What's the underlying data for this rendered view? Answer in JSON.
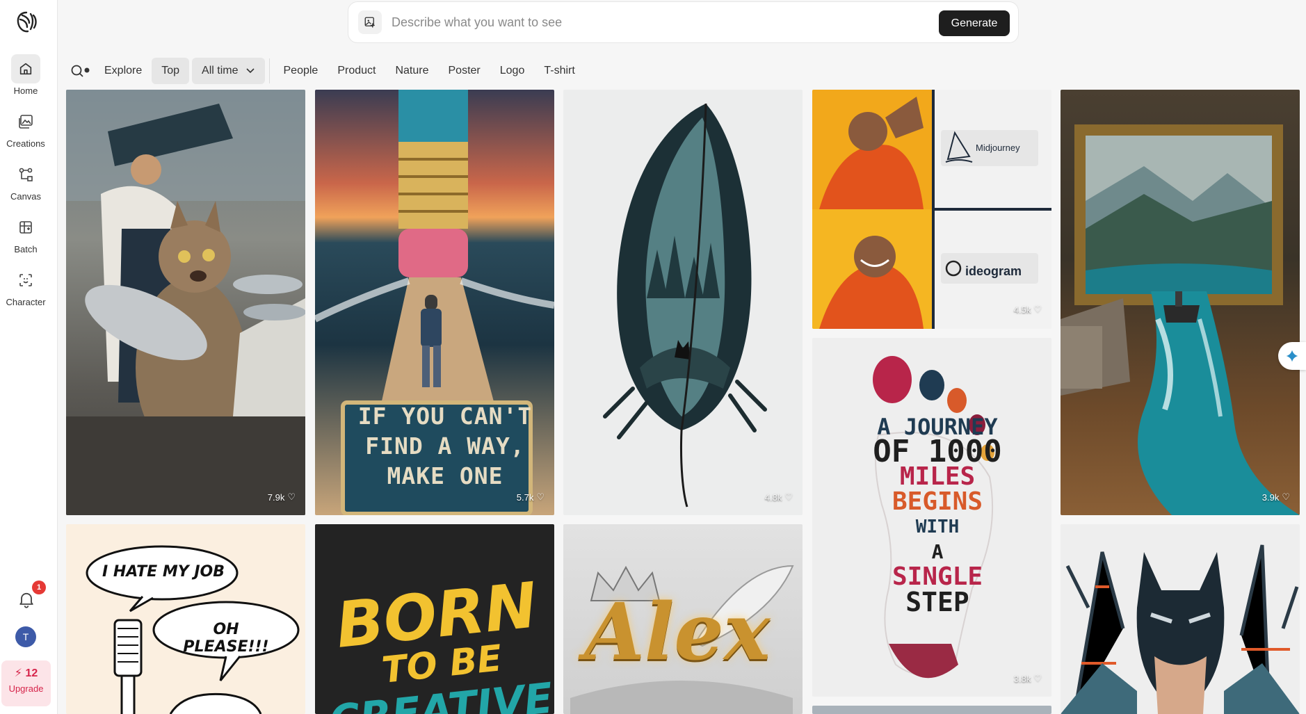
{
  "sidebar": {
    "items": [
      {
        "label": "Home"
      },
      {
        "label": "Creations"
      },
      {
        "label": "Canvas"
      },
      {
        "label": "Batch"
      },
      {
        "label": "Character"
      }
    ],
    "notifications_count": "1",
    "avatar_initial": "T",
    "upgrade": {
      "credits": "12",
      "label": "Upgrade"
    }
  },
  "prompt": {
    "placeholder": "Describe what you want to see",
    "generate_label": "Generate"
  },
  "filters": {
    "explore": "Explore",
    "top": "Top",
    "time": "All time",
    "categories": [
      "People",
      "Product",
      "Nature",
      "Poster",
      "Logo",
      "T-shirt"
    ]
  },
  "gallery": {
    "tiles": [
      {
        "likes": "7.9k"
      },
      {
        "likes": "5.7k",
        "text_lines": [
          "IF YOU CAN'T",
          "FIND A WAY,",
          "MAKE ONE"
        ]
      },
      {
        "likes": "4.8k"
      },
      {
        "likes": "4.5k",
        "brands": [
          "Midjourney",
          "ideogram"
        ]
      },
      {
        "likes": "3.9k"
      },
      {
        "likes": "3.8k",
        "text_lines": [
          "A JOURNEY",
          "OF 1000",
          "MILES",
          "BEGINS",
          "WITH",
          "A",
          "SINGLE",
          "STEP"
        ]
      },
      {
        "bubbles": [
          "I HATE MY JOB",
          "OH PLEASE!!!"
        ]
      },
      {
        "text_lines": [
          "BORN",
          "TO BE",
          "CREATIVE"
        ]
      },
      {
        "text_lines": [
          "Alex"
        ]
      }
    ]
  }
}
